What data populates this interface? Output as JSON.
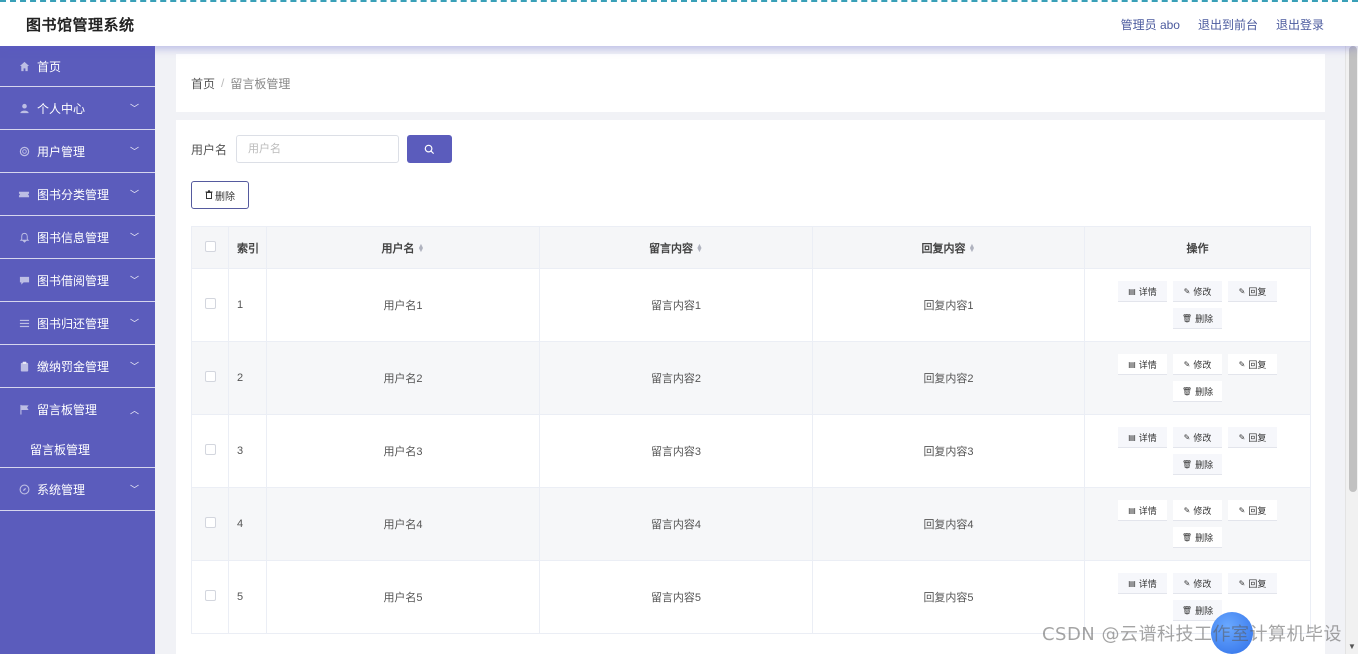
{
  "app": {
    "title": "图书馆管理系统"
  },
  "header": {
    "admin_label": "管理员 abo",
    "front_label": "退出到前台",
    "logout_label": "退出登录"
  },
  "sidebar": {
    "items": [
      {
        "label": "首页",
        "icon": "home-icon"
      },
      {
        "label": "个人中心",
        "icon": "user-icon"
      },
      {
        "label": "用户管理",
        "icon": "circle-icon"
      },
      {
        "label": "图书分类管理",
        "icon": "ticket-icon"
      },
      {
        "label": "图书信息管理",
        "icon": "bell-icon"
      },
      {
        "label": "图书借阅管理",
        "icon": "message-icon"
      },
      {
        "label": "图书归还管理",
        "icon": "list-icon"
      },
      {
        "label": "缴纳罚金管理",
        "icon": "clipboard-icon"
      },
      {
        "label": "留言板管理",
        "icon": "flag-icon"
      },
      {
        "label": "系统管理",
        "icon": "compass-icon"
      }
    ],
    "submenu": {
      "label": "留言板管理"
    }
  },
  "breadcrumb": {
    "home": "首页",
    "separator": "/",
    "current": "留言板管理"
  },
  "search": {
    "label": "用户名",
    "placeholder": "用户名"
  },
  "toolbar": {
    "delete_label": "删除"
  },
  "table": {
    "headers": {
      "index": "索引",
      "username": "用户名",
      "message": "留言内容",
      "reply": "回复内容",
      "actions": "操作"
    },
    "actions": {
      "detail": "详情",
      "edit": "修改",
      "reply": "回复",
      "delete": "删除"
    },
    "rows": [
      {
        "index": "1",
        "username": "用户名1",
        "message": "留言内容1",
        "reply": "回复内容1"
      },
      {
        "index": "2",
        "username": "用户名2",
        "message": "留言内容2",
        "reply": "回复内容2"
      },
      {
        "index": "3",
        "username": "用户名3",
        "message": "留言内容3",
        "reply": "回复内容3"
      },
      {
        "index": "4",
        "username": "用户名4",
        "message": "留言内容4",
        "reply": "回复内容4"
      },
      {
        "index": "5",
        "username": "用户名5",
        "message": "留言内容5",
        "reply": "回复内容5"
      }
    ]
  },
  "watermark": "CSDN @云谱科技工作室计算机毕设",
  "colors": {
    "accent": "#5b5cbc",
    "sidebar": "#5b5cbc"
  }
}
